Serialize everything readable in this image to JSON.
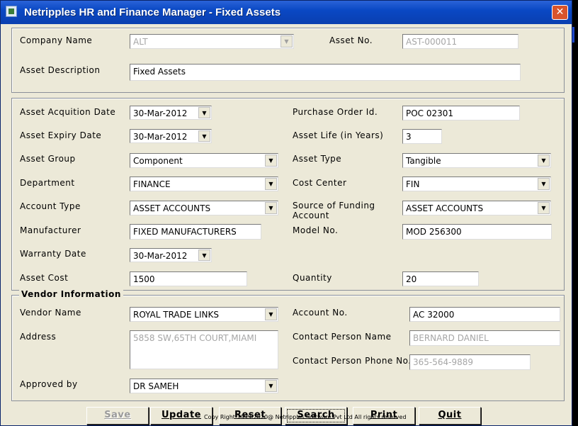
{
  "window": {
    "title": "Netripples HR and Finance Manager - Fixed Assets",
    "close_glyph": "✕"
  },
  "asset": {
    "company_label": "Company Name",
    "company_value": "ALT",
    "asset_no_label": "Asset No.",
    "asset_no_value": "AST-000011",
    "description_label": "Asset Description",
    "description_value": "Fixed Assets"
  },
  "details": {
    "acquisition_label": "Asset Acquition Date",
    "acquisition_value": "30-Mar-2012",
    "po_label": "Purchase Order Id.",
    "po_value": "POC 02301",
    "expiry_label": "Asset Expiry Date",
    "expiry_value": "30-Mar-2012",
    "life_label": "Asset Life (in Years)",
    "life_value": "3",
    "group_label": "Asset Group",
    "group_value": "Component",
    "type_label": "Asset Type",
    "type_value": "Tangible",
    "department_label": "Department",
    "department_value": "FINANCE",
    "cost_center_label": "Cost Center",
    "cost_center_value": "FIN",
    "account_type_label": "Account Type",
    "account_type_value": "ASSET ACCOUNTS",
    "funding_label_line1": "Source of Funding",
    "funding_label_line2": "Account",
    "funding_value": "ASSET ACCOUNTS",
    "manufacturer_label": "Manufacturer",
    "manufacturer_value": "FIXED MANUFACTURERS",
    "model_label": "Model No.",
    "model_value": "MOD 256300",
    "warranty_label": "Warranty Date",
    "warranty_value": "30-Mar-2012",
    "cost_label": "Asset Cost",
    "cost_value": "1500",
    "quantity_label": "Quantity",
    "quantity_value": "20"
  },
  "vendor": {
    "legend": "Vendor Information",
    "name_label": "Vendor Name",
    "name_value": "ROYAL TRADE LINKS",
    "account_label": "Account No.",
    "account_value": "AC 32000",
    "address_label": "Address",
    "address_value": "5858 SW,65TH COURT,MIAMI",
    "contact_label": "Contact Person Name",
    "contact_value": "BERNARD DANIEL",
    "phone_label": "Contact Person Phone No.",
    "phone_value": "365-564-9889",
    "approved_label": "Approved by",
    "approved_value": "DR SAMEH"
  },
  "buttons": {
    "save": "Save",
    "update": "Update",
    "reset": "Reset",
    "search": "Search",
    "print": "Print",
    "quit": "Quit"
  },
  "footer": {
    "copyright": "Copy Right 1999-2020@ Netripples Software Pvt Ltd All rights reserved"
  },
  "icons": {
    "dropdown": "▼"
  },
  "colors": {
    "titlebar": "#0a48c4",
    "window_bg": "#ece9d8",
    "close_button": "#d9542b"
  }
}
